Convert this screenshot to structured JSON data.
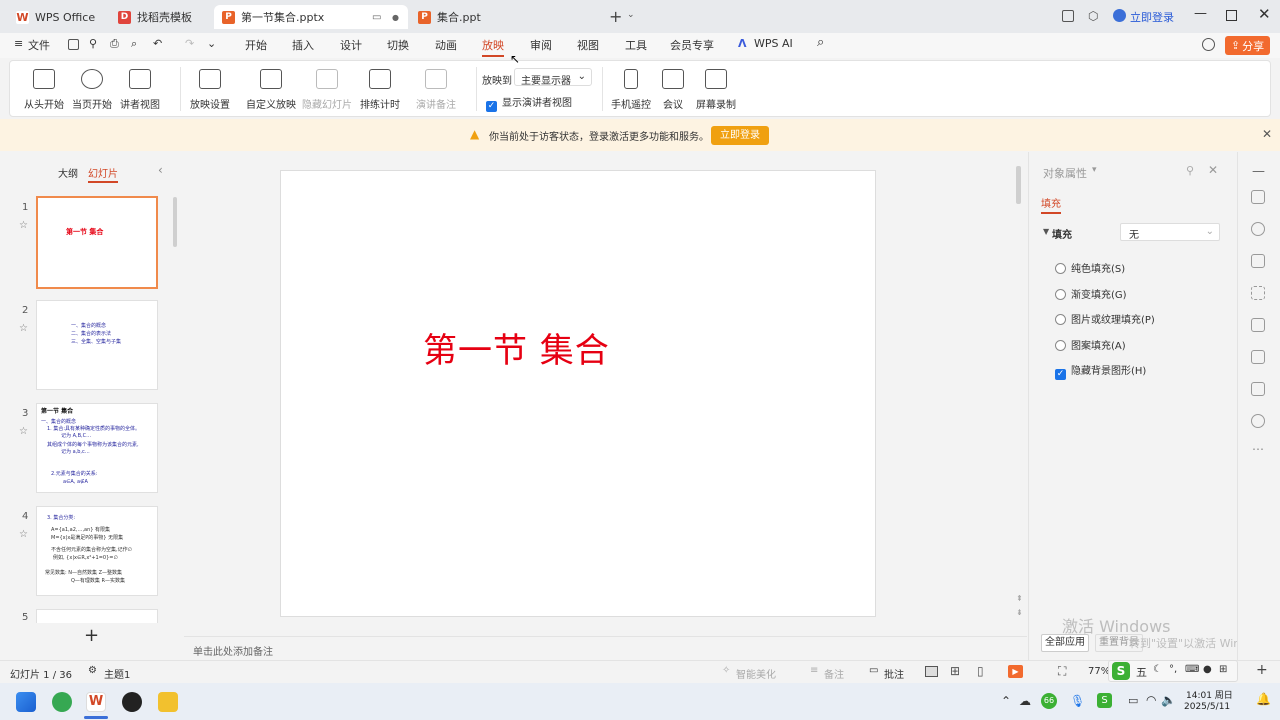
{
  "tabs": [
    {
      "label": "WPS Office",
      "icon": "wps-logo-icon"
    },
    {
      "label": "找稻壳模板",
      "icon": "docer-icon"
    },
    {
      "label": "第一节集合.pptx",
      "icon": "ppt-file-icon"
    },
    {
      "label": "集合.ppt",
      "icon": "ppt-file-icon"
    }
  ],
  "account": {
    "login_label": "立即登录"
  },
  "menu": {
    "file": "文件",
    "items": [
      "开始",
      "插入",
      "设计",
      "切换",
      "动画",
      "放映",
      "审阅",
      "视图",
      "工具",
      "会员专享",
      "WPS AI"
    ],
    "active": "放映",
    "share": "分享"
  },
  "ribbon": {
    "from_start": "从头开始",
    "from_current": "当页开始",
    "presenter_view": "讲者视图",
    "show_settings": "放映设置",
    "custom_show": "自定义放映",
    "hide_slide": "隐藏幻灯片",
    "rehearse": "排练计时",
    "presenter_notes": "演讲备注",
    "show_on_label": "放映到",
    "monitor_value": "主要显示器",
    "show_presenter_view": "显示演讲者视图",
    "phone_remote": "手机遥控",
    "meeting": "会议",
    "screen_record": "屏幕录制"
  },
  "notice": {
    "text": "你当前处于访客状态，登录激活更多功能和服务。",
    "button": "立即登录"
  },
  "panel": {
    "outline_tab": "大纲",
    "slides_tab": "幻灯片"
  },
  "slides": [
    {
      "num": "1",
      "title": "第一节  集合"
    },
    {
      "num": "2",
      "lines": [
        "一、集合的概念",
        "二、集合的表示法",
        "三、全集、空集与子集"
      ]
    },
    {
      "num": "3",
      "title": "第一节 集合",
      "lines": [
        "一、集合的概念",
        "1. 集合:具有某种确定性质的事物的全体。",
        "记为  A,B,C…",
        "其组成个体的每个事物称为该集合的元素,",
        "记为  a,b,c…",
        "2.元素与集合的关系:",
        "a∈A,        a∉A"
      ]
    },
    {
      "num": "4",
      "lines": [
        "3. 集合分类:",
        "A={a1,a2,…,an}        有限集",
        "M={x|x是满足P的事物}     无限集",
        "不含任何元素的集合称为空集,记作∅",
        "例如, {x|x∈R,x²+1=0}=∅",
        "常见数集: N—自然数集    Z—整数集",
        "Q—有理数集    R—实数集"
      ]
    },
    {
      "num": "5"
    }
  ],
  "main_slide": {
    "title": "第一节  集合"
  },
  "notes_placeholder": "单击此处添加备注",
  "properties": {
    "title": "对象属性",
    "fill_tab": "填充",
    "fill_label": "填充",
    "fill_value": "无",
    "options": [
      "纯色填充(S)",
      "渐变填充(G)",
      "图片或纹理填充(P)",
      "图案填充(A)"
    ],
    "hide_bg": "隐藏背景图形(H)",
    "apply_all": "全部应用",
    "reset_bg": "重置背景"
  },
  "watermark": {
    "line1": "激活 Windows",
    "line2": "转到\"设置\"以激活 Windows。"
  },
  "status": {
    "slide_counter": "幻灯片 1 / 36",
    "theme": "主题1",
    "beautify": "智能美化",
    "notes": "备注",
    "comment": "批注",
    "zoom": "77%"
  },
  "ime": {
    "mode": "五"
  },
  "clock": {
    "time": "14:01 周日",
    "date": "2025/5/11"
  },
  "colors": {
    "accent": "#d24726",
    "slide_title": "#e60012",
    "notice_btn": "#f0a010",
    "share": "#f26a2e"
  }
}
